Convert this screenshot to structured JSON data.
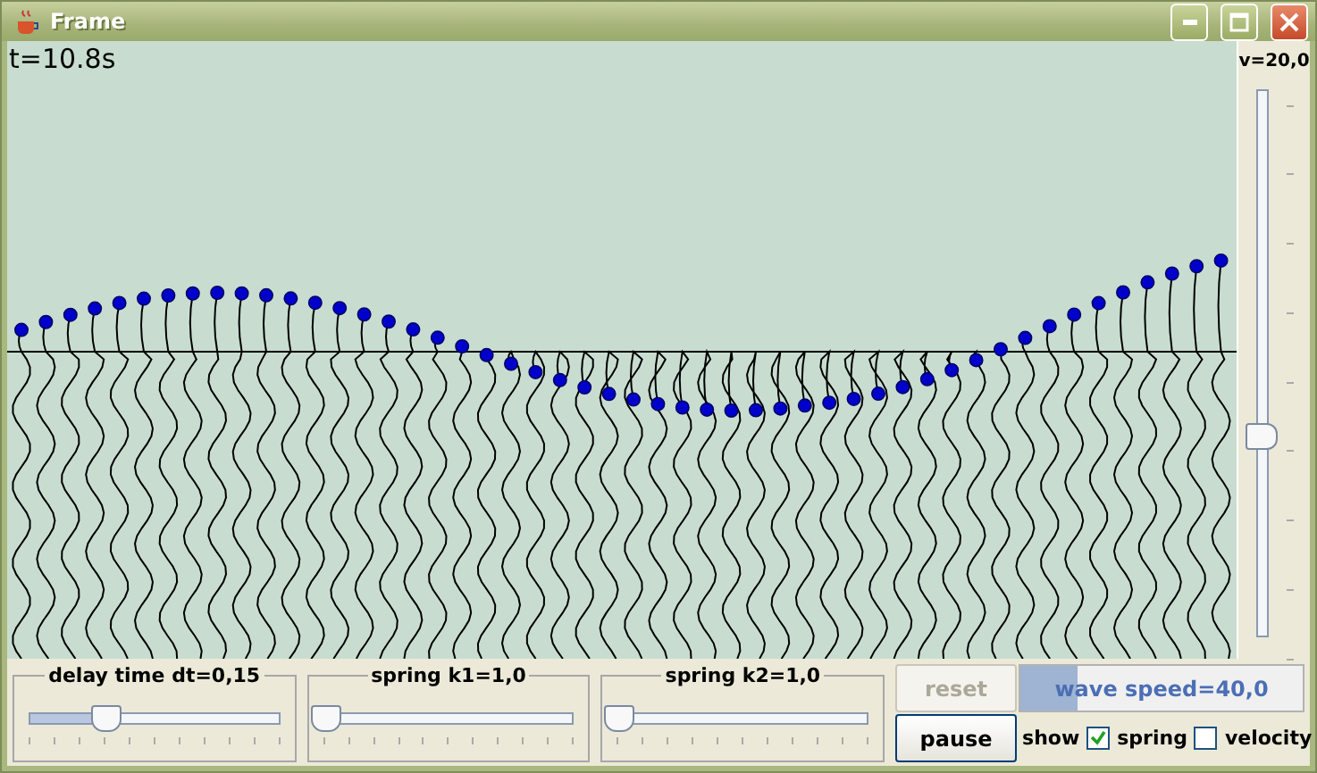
{
  "window": {
    "title": "Frame"
  },
  "time": "t=10.8s",
  "velocity_slider": {
    "label": "v=20,0",
    "level": 0.37
  },
  "show_spring": true,
  "show_velocity": false,
  "sliders": [
    {
      "label": "delay time dt=0,15",
      "level": 0.3
    },
    {
      "label": "spring k1=1,0",
      "level": 0
    },
    {
      "label": "spring k2=1,0",
      "level": 0
    }
  ],
  "reset": {
    "label": "reset",
    "disabled": true
  },
  "wave_speed": {
    "label": "wave speed=40,0",
    "level": 0.2
  },
  "pause": {
    "label": "pause"
  },
  "show_label": "show",
  "checkboxes": [
    {
      "label": "spring",
      "checked": true
    },
    {
      "label": "velocity",
      "checked": false
    }
  ]
}
